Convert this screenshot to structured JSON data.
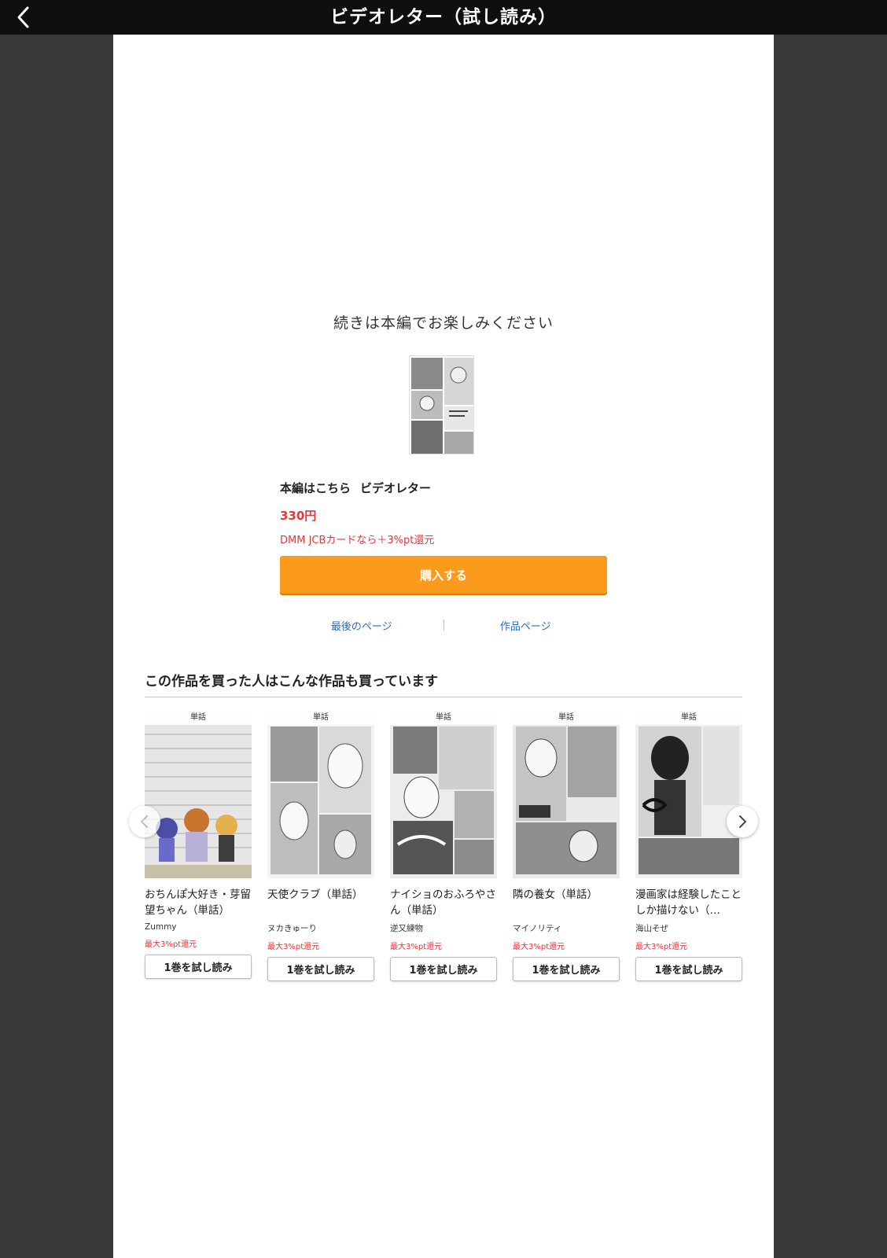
{
  "header": {
    "title": "ビデオレター（試し読み）",
    "back_icon": "chevron-left-icon"
  },
  "end_panel": {
    "message": "続きは本編でお楽しみください",
    "buy_prefix": "本編はこちら",
    "work_title": "ビデオレター",
    "price": "330円",
    "pt_note": "DMM JCBカードなら＋3%pt還元",
    "buy_button": "購入する",
    "last_page_link": "最後のページ",
    "work_page_link": "作品ページ"
  },
  "recommend": {
    "heading": "この作品を買った人はこんな作品も買っています",
    "items": [
      {
        "badge": "単話",
        "title": "おちんぽ大好き・芽留望ちゃん（単話）",
        "author": "Zummy",
        "pt": "最大3%pt還元",
        "button": "1巻を試し読み"
      },
      {
        "badge": "単話",
        "title": "天使クラブ（単話）",
        "author": "ヌカきゅーり",
        "pt": "最大3%pt還元",
        "button": "1巻を試し読み"
      },
      {
        "badge": "単話",
        "title": "ナイショのおふろやさん（単話）",
        "author": "逆又練物",
        "pt": "最大3%pt還元",
        "button": "1巻を試し読み"
      },
      {
        "badge": "単話",
        "title": "隣の養女（単話）",
        "author": "マイノリティ",
        "pt": "最大3%pt還元",
        "button": "1巻を試し読み"
      },
      {
        "badge": "単話",
        "title": "漫画家は経験したことしか描けない（…",
        "author": "海山そぜ",
        "pt": "最大3%pt還元",
        "button": "1巻を試し読み"
      }
    ],
    "prev_icon": "chevron-left-icon",
    "next_icon": "chevron-right-icon"
  },
  "colors": {
    "accent": "#fb9a1d",
    "price": "#e5383b",
    "link": "#2b6cb3",
    "header_bg": "#0f0f0f",
    "backdrop": "#383838"
  }
}
